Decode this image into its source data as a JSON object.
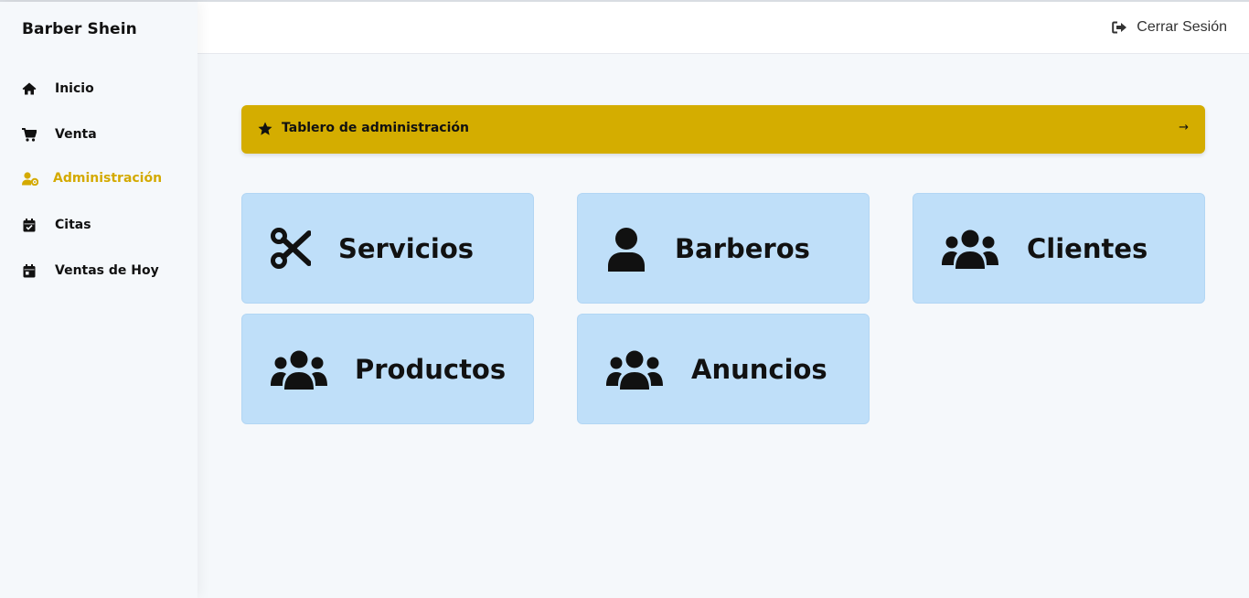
{
  "brand": "Barber Shein",
  "sidebar": {
    "items": [
      {
        "label": "Inicio",
        "icon": "home-icon"
      },
      {
        "label": "Venta",
        "icon": "cart-icon"
      },
      {
        "label": "Administración",
        "icon": "user-gear-icon",
        "active": true
      },
      {
        "label": "Citas",
        "icon": "calendar-check-icon"
      },
      {
        "label": "Ventas de Hoy",
        "icon": "calendar-day-icon"
      }
    ]
  },
  "header": {
    "logout_label": "Cerrar Sesión",
    "logout_icon": "sign-out-icon"
  },
  "banner": {
    "title": "Tablero de administración",
    "arrow": "→",
    "icon": "star-icon"
  },
  "cards": [
    {
      "label": "Servicios",
      "icon": "scissors-icon"
    },
    {
      "label": "Barberos",
      "icon": "user-icon"
    },
    {
      "label": "Clientes",
      "icon": "users-icon"
    },
    {
      "label": "Productos",
      "icon": "users-icon"
    },
    {
      "label": "Anuncios",
      "icon": "users-icon"
    }
  ],
  "colors": {
    "accent": "#d4aa00",
    "banner_bg": "#d4ad00",
    "card_bg": "#bfdff9",
    "page_bg": "#f5f8fb"
  }
}
